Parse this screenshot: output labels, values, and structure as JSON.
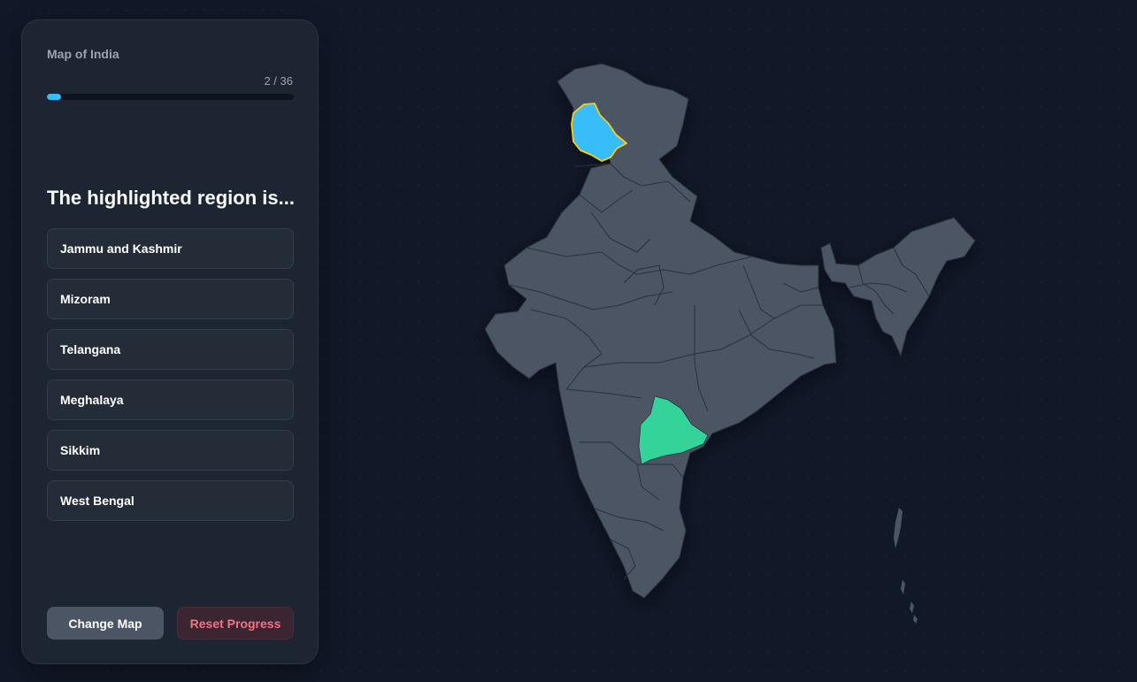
{
  "panel": {
    "map_title": "Map of India",
    "progress_text": "2 / 36",
    "progress_value": 0.056,
    "question": "The highlighted region is...",
    "options": [
      {
        "label": "Jammu and Kashmir"
      },
      {
        "label": "Mizoram"
      },
      {
        "label": "Telangana"
      },
      {
        "label": "Meghalaya"
      },
      {
        "label": "Sikkim"
      },
      {
        "label": "West Bengal"
      }
    ],
    "change_map_label": "Change Map",
    "reset_label": "Reset Progress"
  },
  "map": {
    "highlighted_region": "Jammu and Kashmir",
    "answered_region": "Telangana",
    "colors": {
      "land": "#4b5563",
      "border": "#2a313d",
      "highlight": "#38bdf8",
      "highlight_outline": "#facc15",
      "answered": "#34d399"
    }
  }
}
